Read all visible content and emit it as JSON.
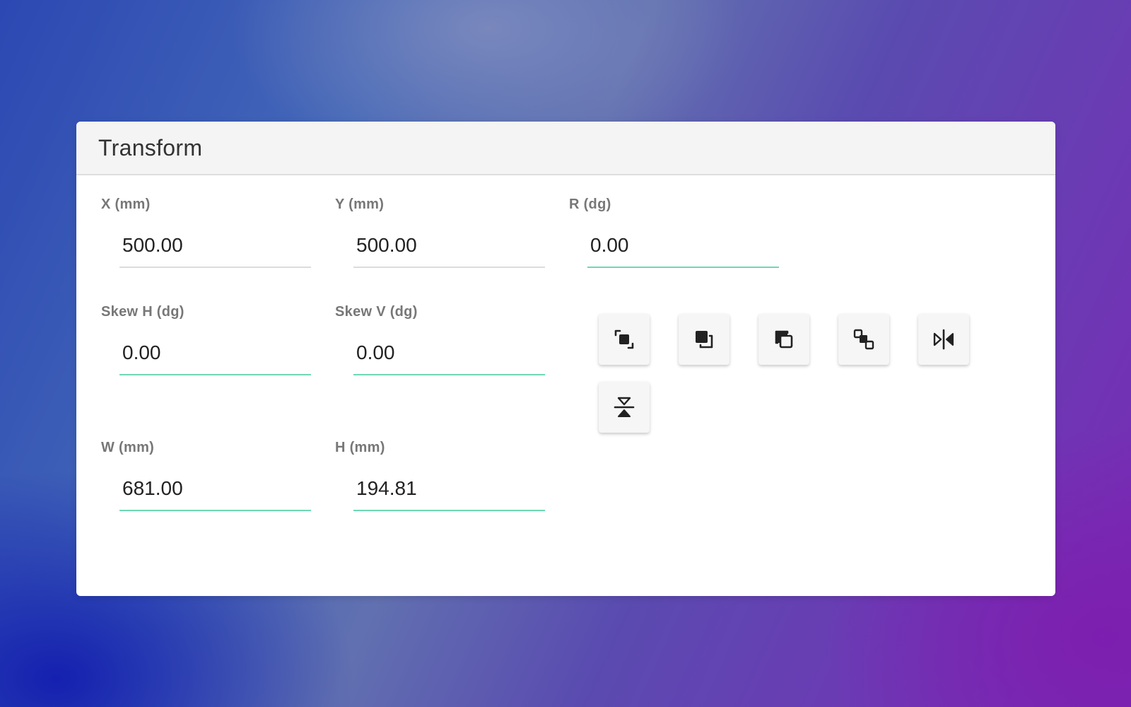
{
  "panel": {
    "title": "Transform"
  },
  "fields": {
    "x": {
      "label": "X (mm)",
      "value": "500.00"
    },
    "y": {
      "label": "Y (mm)",
      "value": "500.00"
    },
    "r": {
      "label": "R (dg)",
      "value": "0.00"
    },
    "skew_h": {
      "label": "Skew H (dg)",
      "value": "0.00"
    },
    "skew_v": {
      "label": "Skew V (dg)",
      "value": "0.00"
    },
    "w": {
      "label": "W (mm)",
      "value": "681.00"
    },
    "h": {
      "label": "H (mm)",
      "value": "194.81"
    }
  },
  "tools": [
    {
      "icon": "select-object-icon"
    },
    {
      "icon": "bring-to-front-icon"
    },
    {
      "icon": "send-to-back-icon"
    },
    {
      "icon": "arrange-icon"
    },
    {
      "icon": "flip-horizontal-icon"
    },
    {
      "icon": "flip-vertical-icon"
    }
  ],
  "colors": {
    "active_underline": "#6fd8b4",
    "inactive_underline": "#dcdcdc",
    "header_bg": "#f4f4f4",
    "icon": "#222222"
  }
}
